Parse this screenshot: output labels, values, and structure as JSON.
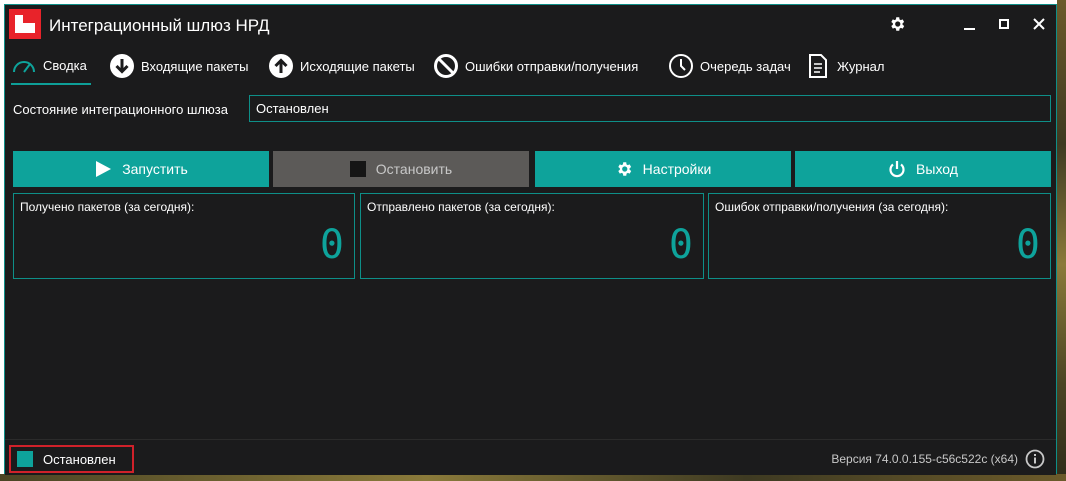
{
  "window": {
    "title": "Интеграционный шлюз НРД"
  },
  "tabs": [
    {
      "label": "Сводка",
      "icon": "gauge-icon"
    },
    {
      "label": "Входящие пакеты",
      "icon": "arrow-down-circle-icon"
    },
    {
      "label": "Исходящие пакеты",
      "icon": "arrow-up-circle-icon"
    },
    {
      "label": "Ошибки отправки/получения",
      "icon": "no-entry-icon"
    },
    {
      "label": "Очередь задач",
      "icon": "clock-icon"
    },
    {
      "label": "Журнал",
      "icon": "document-icon"
    }
  ],
  "state": {
    "label": "Состояние интеграционного шлюза",
    "value": "Остановлен"
  },
  "actions": {
    "start": "Запустить",
    "stop": "Остановить",
    "settings": "Настройки",
    "exit": "Выход"
  },
  "counters": {
    "received": {
      "label": "Получено пакетов (за сегодня):",
      "value": "0"
    },
    "sent": {
      "label": "Отправлено пакетов (за сегодня):",
      "value": "0"
    },
    "errors": {
      "label": "Ошибок отправки/получения (за сегодня):",
      "value": "0"
    }
  },
  "statusbar": {
    "status": "Остановлен",
    "version": "Версия 74.0.0.155-c56c522c (x64)"
  },
  "colors": {
    "accent": "#0ea39b",
    "stop_disabled": "#5c5a58",
    "highlight": "#d0212a",
    "logo": "#e8232a"
  }
}
